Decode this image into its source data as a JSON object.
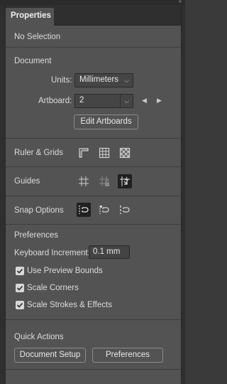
{
  "panel": {
    "tab_label": "Properties",
    "collapse_glyph": "››"
  },
  "selection": {
    "text": "No Selection"
  },
  "document": {
    "heading": "Document",
    "units_label": "Units:",
    "units_value": "Millimeters",
    "artboard_label": "Artboard:",
    "artboard_value": "2",
    "edit_artboards_label": "Edit Artboards"
  },
  "ruler_grids": {
    "label": "Ruler & Grids",
    "icons": [
      "ruler-icon",
      "grid-icon",
      "transparency-grid-icon"
    ]
  },
  "guides": {
    "label": "Guides",
    "icons": [
      "show-guides-icon",
      "lock-guides-icon",
      "smart-guides-icon"
    ],
    "active": "smart-guides-icon"
  },
  "snap_options": {
    "label": "Snap Options",
    "icons": [
      "snap-to-point-icon",
      "snap-to-pixel-icon",
      "snap-to-grid-icon"
    ],
    "active": "snap-to-point-icon"
  },
  "preferences": {
    "heading": "Preferences",
    "keyboard_increment_label": "Keyboard Increment:",
    "keyboard_increment_value": "0.1 mm",
    "checkboxes": [
      {
        "label": "Use Preview Bounds",
        "checked": true
      },
      {
        "label": "Scale Corners",
        "checked": true
      },
      {
        "label": "Scale Strokes & Effects",
        "checked": true
      }
    ]
  },
  "quick_actions": {
    "heading": "Quick Actions",
    "document_setup_label": "Document Setup",
    "preferences_label": "Preferences"
  },
  "colors": {
    "panel_bg": "#535353",
    "frame_bg": "#2f2f2f",
    "active_icon_bg": "#202020",
    "checkbox_fill": "#d8d8d8"
  }
}
